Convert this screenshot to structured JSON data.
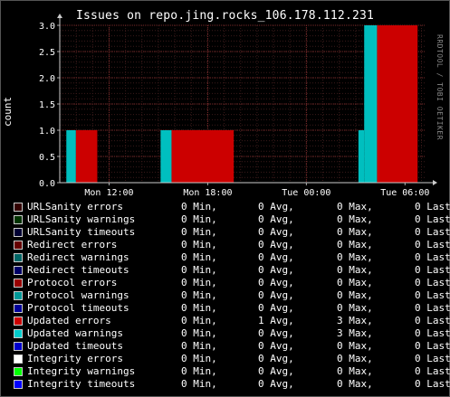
{
  "window": {
    "title": "Issues on repo.jing.rocks_106.178.112.231",
    "watermark": "RRDTOOL / TOBI OETIKER"
  },
  "chart_data": {
    "type": "area",
    "title": "Issues on repo.jing.rocks_106.178.112.231",
    "ylabel": "count",
    "ylim": [
      0,
      3.0
    ],
    "y_ticks": [
      "0.0",
      "0.5",
      "1.0",
      "1.5",
      "2.0",
      "2.5",
      "3.0"
    ],
    "x_ticks": [
      "Mon 12:00",
      "Mon 18:00",
      "Tue 00:00",
      "Tue 06:00"
    ],
    "grid": true,
    "series": [
      {
        "name": "Updated warnings",
        "color": "#00bfbf",
        "segments": [
          {
            "start": "Mon 09:24",
            "end": "Mon 09:59",
            "value": 1
          },
          {
            "start": "Mon 15:08",
            "end": "Mon 15:48",
            "value": 1
          },
          {
            "start": "Tue 03:10",
            "end": "Tue 03:31",
            "value": 1
          },
          {
            "start": "Tue 03:31",
            "end": "Tue 04:18",
            "value": 3
          }
        ]
      },
      {
        "name": "Updated errors",
        "color": "#cc0000",
        "segments": [
          {
            "start": "Mon 09:59",
            "end": "Mon 11:17",
            "value": 1
          },
          {
            "start": "Mon 15:48",
            "end": "Mon 19:35",
            "value": 1
          },
          {
            "start": "Tue 04:18",
            "end": "Tue 06:46",
            "value": 3
          }
        ]
      }
    ]
  },
  "legend": [
    {
      "label": "URLSanity errors",
      "color": "#330000",
      "min": "0 Min,",
      "avg": "0 Avg,",
      "max": "0 Max,",
      "last": "0 Last"
    },
    {
      "label": "URLSanity warnings",
      "color": "#003300",
      "min": "0 Min,",
      "avg": "0 Avg,",
      "max": "0 Max,",
      "last": "0 Last"
    },
    {
      "label": "URLSanity timeouts",
      "color": "#000033",
      "min": "0 Min,",
      "avg": "0 Avg,",
      "max": "0 Max,",
      "last": "0 Last"
    },
    {
      "label": "Redirect errors",
      "color": "#660000",
      "min": "0 Min,",
      "avg": "0 Avg,",
      "max": "0 Max,",
      "last": "0 Last"
    },
    {
      "label": "Redirect warnings",
      "color": "#006666",
      "min": "0 Min,",
      "avg": "0 Avg,",
      "max": "0 Max,",
      "last": "0 Last"
    },
    {
      "label": "Redirect timeouts",
      "color": "#000066",
      "min": "0 Min,",
      "avg": "0 Avg,",
      "max": "0 Max,",
      "last": "0 Last"
    },
    {
      "label": "Protocol errors",
      "color": "#990000",
      "min": "0 Min,",
      "avg": "0 Avg,",
      "max": "0 Max,",
      "last": "0 Last"
    },
    {
      "label": "Protocol warnings",
      "color": "#009999",
      "min": "0 Min,",
      "avg": "0 Avg,",
      "max": "0 Max,",
      "last": "0 Last"
    },
    {
      "label": "Protocol timeouts",
      "color": "#000099",
      "min": "0 Min,",
      "avg": "0 Avg,",
      "max": "0 Max,",
      "last": "0 Last"
    },
    {
      "label": "Updated errors",
      "color": "#cc0000",
      "min": "0 Min,",
      "avg": "1 Avg,",
      "max": "3 Max,",
      "last": "0 Last"
    },
    {
      "label": "Updated warnings",
      "color": "#00cccc",
      "min": "0 Min,",
      "avg": "0 Avg,",
      "max": "3 Max,",
      "last": "0 Last"
    },
    {
      "label": "Updated timeouts",
      "color": "#0000cc",
      "min": "0 Min,",
      "avg": "0 Avg,",
      "max": "0 Max,",
      "last": "0 Last"
    },
    {
      "label": "Integrity errors",
      "color": "#ffffff",
      "min": "0 Min,",
      "avg": "0 Avg,",
      "max": "0 Max,",
      "last": "0 Last"
    },
    {
      "label": "Integrity warnings",
      "color": "#00ff00",
      "min": "0 Min,",
      "avg": "0 Avg,",
      "max": "0 Max,",
      "last": "0 Last"
    },
    {
      "label": "Integrity timeouts",
      "color": "#0000ff",
      "min": "0 Min,",
      "avg": "0 Avg,",
      "max": "0 Max,",
      "last": "0 Last"
    }
  ]
}
